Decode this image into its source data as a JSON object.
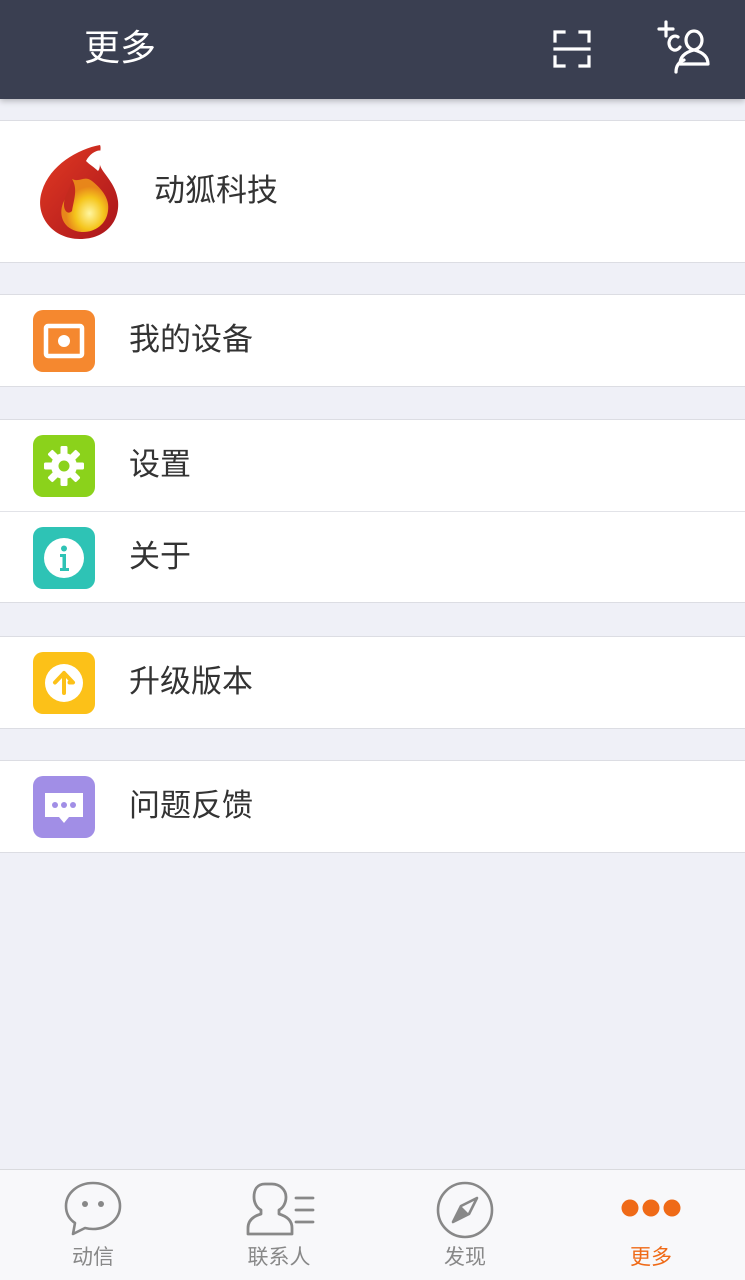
{
  "header": {
    "title": "更多",
    "bg_color": "#3a3f51",
    "icons": [
      "scan-icon",
      "add-contact-icon"
    ]
  },
  "profile": {
    "name": "动狐科技",
    "logo_icon": "fox-logo-icon"
  },
  "menu_groups": [
    {
      "items": [
        {
          "label": "我的设备",
          "icon": "device-icon",
          "color": "#f5882f"
        }
      ]
    },
    {
      "items": [
        {
          "label": "设置",
          "icon": "gear-icon",
          "color": "#8bd21b"
        },
        {
          "label": "关于",
          "icon": "info-icon",
          "color": "#2ec3b5"
        }
      ]
    },
    {
      "items": [
        {
          "label": "升级版本",
          "icon": "upgrade-icon",
          "color": "#fcc118"
        }
      ]
    },
    {
      "items": [
        {
          "label": "问题反馈",
          "icon": "feedback-icon",
          "color": "#a18ee6"
        }
      ]
    }
  ],
  "tabbar": {
    "active_color": "#ef6a17",
    "tabs": [
      {
        "label": "动信",
        "icon": "chat-bubble-icon",
        "active": false
      },
      {
        "label": "联系人",
        "icon": "contacts-icon",
        "active": false
      },
      {
        "label": "发现",
        "icon": "compass-icon",
        "active": false
      },
      {
        "label": "更多",
        "icon": "more-dots-icon",
        "active": true
      }
    ]
  }
}
